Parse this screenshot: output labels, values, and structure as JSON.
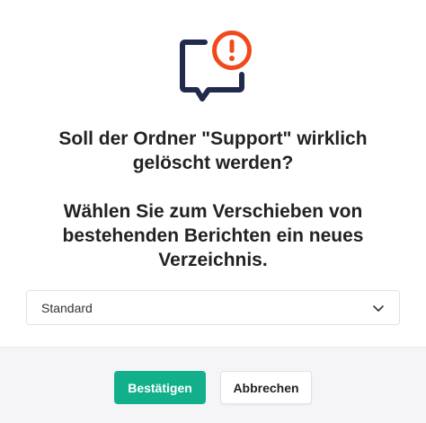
{
  "dialog": {
    "title_line1": "Soll der Ordner \"Support\" wirklich gelöscht werden?",
    "title_line2": "Wählen Sie zum Verschieben von bestehenden Berichten ein neues Verzeichnis.",
    "icon": "chat-warning-icon",
    "colors": {
      "icon_outline": "#1f2a4d",
      "warning": "#ef4a1c",
      "confirm": "#12b08a"
    }
  },
  "folder_select": {
    "value": "Standard"
  },
  "footer": {
    "confirm_label": "Bestätigen",
    "cancel_label": "Abbrechen"
  }
}
